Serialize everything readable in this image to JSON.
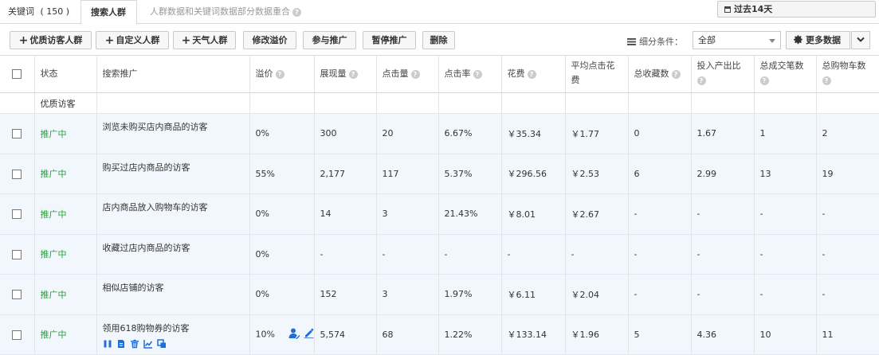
{
  "tabs": [
    {
      "label": "关键词",
      "count": "( 150 )"
    },
    {
      "label": "搜索人群"
    },
    {
      "label": "人群数据和关键词数据部分数据重合"
    }
  ],
  "date_button": {
    "label": "过去14天"
  },
  "toolbar": {
    "add_quality": "优质访客人群",
    "add_custom": "自定义人群",
    "add_weather": "天气人群",
    "edit_premium": "修改溢价",
    "join": "参与推广",
    "pause": "暂停推广",
    "delete": "删除",
    "segment_label": "细分条件：",
    "segment_value": "全部",
    "more_data": "更多数据"
  },
  "table": {
    "headers": {
      "status": "状态",
      "promo": "搜索推广",
      "premium": "溢价",
      "impressions": "展现量",
      "clicks": "点击量",
      "ctr": "点击率",
      "cost": "花费",
      "avg_cpc": "平均点击花费",
      "favorites": "总收藏数",
      "roi": "投入产出比",
      "orders": "总成交笔数",
      "carts": "总购物车数"
    },
    "group_label": "优质访客",
    "rows": [
      {
        "status": "推广中",
        "name": "浏览未购买店内商品的访客",
        "premium": "0%",
        "impressions": "300",
        "clicks": "20",
        "ctr": "6.67%",
        "cost": "￥35.34",
        "cpc": "￥1.77",
        "fav": "0",
        "roi": "1.67",
        "orders": "1",
        "carts": "2"
      },
      {
        "status": "推广中",
        "name": "购买过店内商品的访客",
        "premium": "55%",
        "impressions": "2,177",
        "clicks": "117",
        "ctr": "5.37%",
        "cost": "￥296.56",
        "cpc": "￥2.53",
        "fav": "6",
        "roi": "2.99",
        "orders": "13",
        "carts": "19"
      },
      {
        "status": "推广中",
        "name": "店内商品放入购物车的访客",
        "premium": "0%",
        "impressions": "14",
        "clicks": "3",
        "ctr": "21.43%",
        "cost": "￥8.01",
        "cpc": "￥2.67",
        "fav": "-",
        "roi": "-",
        "orders": "-",
        "carts": "-"
      },
      {
        "status": "推广中",
        "name": "收藏过店内商品的访客",
        "premium": "0%",
        "impressions": "-",
        "clicks": "-",
        "ctr": "-",
        "cost": "-",
        "cpc": "-",
        "fav": "-",
        "roi": "-",
        "orders": "-",
        "carts": "-"
      },
      {
        "status": "推广中",
        "name": "相似店铺的访客",
        "premium": "0%",
        "impressions": "152",
        "clicks": "3",
        "ctr": "1.97%",
        "cost": "￥6.11",
        "cpc": "￥2.04",
        "fav": "-",
        "roi": "-",
        "orders": "-",
        "carts": "-"
      },
      {
        "status": "推广中",
        "name": "领用618购物券的访客",
        "premium": "10%",
        "impressions": "5,574",
        "clicks": "68",
        "ctr": "1.22%",
        "cost": "￥133.14",
        "cpc": "￥1.96",
        "fav": "5",
        "roi": "4.36",
        "orders": "10",
        "carts": "11"
      }
    ]
  },
  "colors": {
    "status_active": "#28a33a",
    "icon_blue": "#1e6fd9",
    "row_bg": "#f2f7fd"
  },
  "icons": {
    "row_actions": [
      "pause-icon",
      "report-icon",
      "trash-icon",
      "trend-icon",
      "copy-icon"
    ],
    "premium_tools": [
      "user-edit-icon",
      "pencil-icon"
    ]
  }
}
